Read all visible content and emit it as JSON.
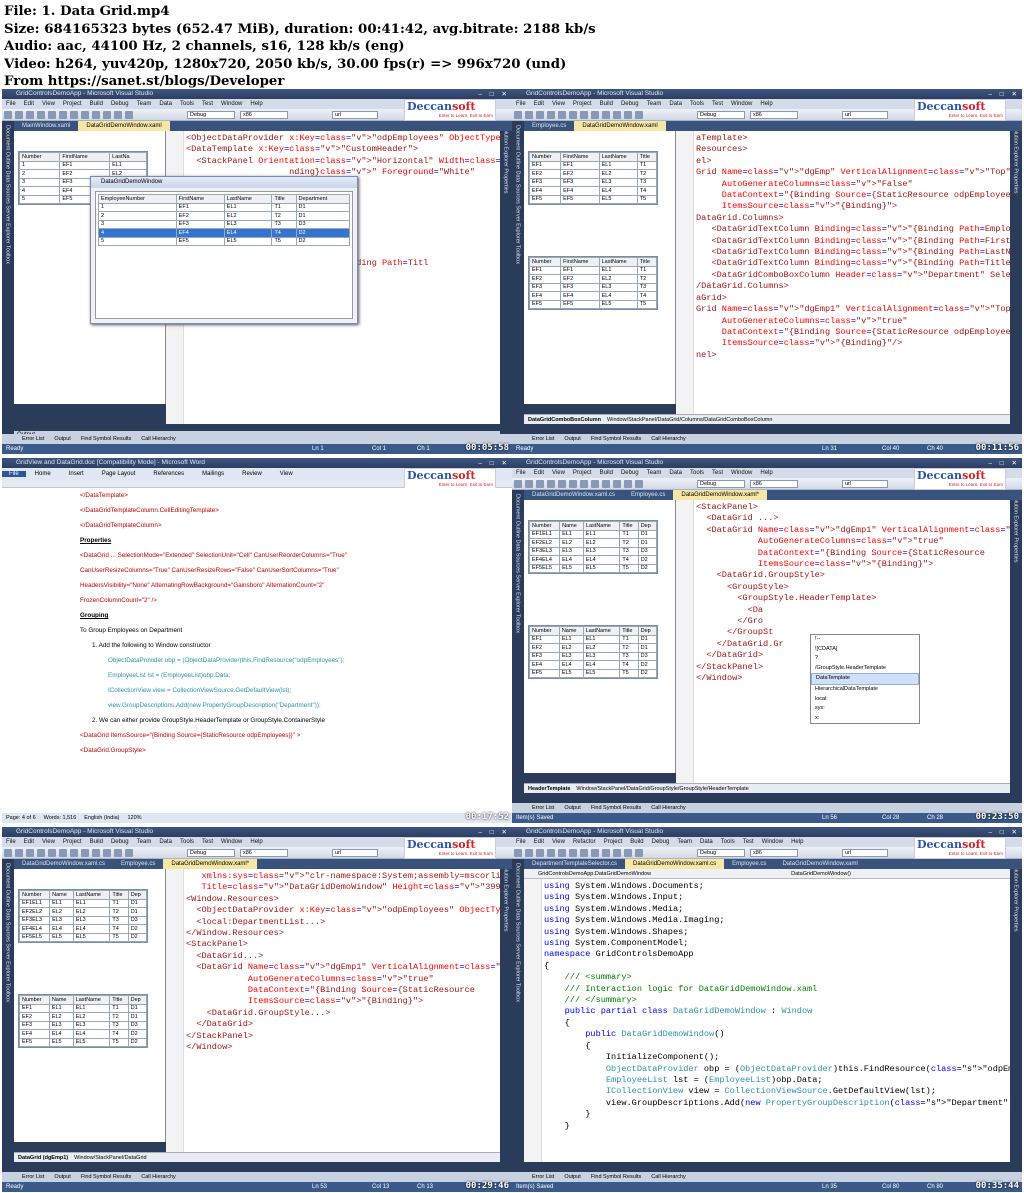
{
  "header": {
    "file": "File: 1. Data Grid.mp4",
    "size": "Size: 684165323 bytes (652.47 MiB), duration: 00:41:42, avg.bitrate: 2188 kb/s",
    "audio": "Audio: aac, 44100 Hz, 2 channels, s16, 128 kb/s (eng)",
    "video": "Video: h264, yuv420p, 1280x720, 2050 kb/s, 30.00 fps(r) => 996x720 (und)",
    "from": "From https://sanet.st/blogs/Developer"
  },
  "colors": {
    "vs_frame": "#2b3b5a",
    "tab_active": "#f7e7a6",
    "xaml_tag": "#a31515",
    "xaml_attr": "#ff0000",
    "xaml_value": "#0000ff",
    "csharp_keyword": "#0000ff",
    "csharp_type": "#2b91af",
    "comment": "#008000",
    "status_bar": "#3a5a8a"
  },
  "vs": {
    "title": "GridControlsDemoApp - Microsoft Visual Studio",
    "menu": [
      "File",
      "Edit",
      "View",
      "Project",
      "Build",
      "Debug",
      "Team",
      "Data",
      "Tools",
      "Test",
      "Window",
      "Help"
    ],
    "menu_refactor": [
      "File",
      "Edit",
      "View",
      "Refactor",
      "Project",
      "Build",
      "Debug",
      "Team",
      "Data",
      "Tools",
      "Test",
      "Window",
      "Help"
    ],
    "config": "Debug",
    "platform": "x86",
    "find": "url",
    "logo": {
      "brand_a": "Deccan",
      "brand_b": "soft",
      "tagline": "Enter to Learn, Exit to Earn"
    },
    "left_panel": "Document Outline  Data Sources  Server Explorer  Toolbox",
    "right_panel": "Solution Explorer  Properties",
    "bottom_tabs": [
      "Error List",
      "Output",
      "Find Symbol Results",
      "Call Hierarchy"
    ],
    "status_ready": "Ready",
    "status_saved": "Item(s) Saved",
    "zoom": "100 %"
  },
  "grid_headers": [
    "EmployeeNumber",
    "FirstName",
    "LastName",
    "Title",
    "Department"
  ],
  "grid_headers_short": [
    "Number",
    "FirstName",
    "LastNa"
  ],
  "grid_rows": [
    [
      "1",
      "EF1",
      "EL1",
      "T1",
      "D1"
    ],
    [
      "2",
      "EF2",
      "EL2",
      "T2",
      "D1"
    ],
    [
      "3",
      "EF3",
      "EL3",
      "T3",
      "D3"
    ],
    [
      "4",
      "EF4",
      "EL4",
      "T4",
      "D2"
    ],
    [
      "5",
      "EF5",
      "EL5",
      "T5",
      "D2"
    ]
  ],
  "tiles": [
    {
      "tabs": [
        "MainWindow.xaml",
        "DataGridDemoWindow.xaml"
      ],
      "popup_title": "DataGridDemoWindow",
      "output_title": "Output",
      "output_from": "Show output from:",
      "output_source": "Build",
      "status": {
        "ln": "Ln 1",
        "col": "Col 1",
        "ch": "Ch 1"
      },
      "time": "00:05:58",
      "code": [
        "<ObjectDataProvider x:Key=\"odpEmployees\" ObjectType=\"{x",
        "<DataTemplate x:Key=\"CustomHeader\">",
        "  <StackPanel Orientation=\"Horizontal\" Width=\"100\" Ba",
        "                    nding}\" Foreground=\"White\"",
        "",
        "",
        "",
        "lAlignment=\"Top\"",
        "\"False\"",
        "ng Source={StaticResource",
        "}\">",
        "",
        "Binding=\"{Binding Path=Empl",
        "Binding=\"{Binding Path=Firs",
        "Binding=\"{Binding Path=Last",
        "<DataGridTextColumn Binding=\"{Binding Path=Titl"
      ]
    },
    {
      "tabs": [
        "Employee.cs",
        "DataGridDemoWindow.xaml"
      ],
      "breadcrumb_bold": "DataGridComboBoxColumn",
      "breadcrumb": "Window/StackPanel/DataGrid/Columns/DataGridComboBoxColumn",
      "status": {
        "ln": "Ln 31",
        "col": "Col 40",
        "ch": "Ch 40"
      },
      "time": "00:11:56",
      "code": [
        "aTemplate>",
        "Resources>",
        "el>",
        "Grid Name=\"dgEmp\" VerticalAlignment=\"Top\"",
        "     AutoGenerateColumns=\"False\"",
        "     DataContext=\"{Binding Source={StaticResource odpEmployees}",
        "     ItemsSource=\"{Binding}\">",
        "DataGrid.Columns>",
        "   <DataGridTextColumn Binding=\"{Binding Path=EmployeeNumber}\"",
        "   <DataGridTextColumn Binding=\"{Binding Path=FirstName}\" Heade",
        "   <DataGridTextColumn Binding=\"{Binding Path=LastName}\" Header",
        "   <DataGridTextColumn Binding=\"{Binding Path=Title}\" Header=\"T",
        "   <DataGridComboBoxColumn Header=\"Department\" SelectedItemBind",
        "/DataGrid.Columns>",
        "aGrid>",
        "Grid Name=\"dgEmp1\" VerticalAlignment=\"Top\"",
        "     AutoGenerateColumns=\"true\"",
        "     DataContext=\"{Binding Source={StaticResource odpEmployees}",
        "     ItemsSource=\"{Binding}\"/>",
        "",
        "nel>"
      ]
    },
    {
      "title": "GridView and DataGrid.doc [Compatibility Mode] - Microsoft Word",
      "ribbon": [
        "File",
        "Home",
        "Insert",
        "Page Layout",
        "References",
        "Mailings",
        "Review",
        "View"
      ],
      "status": {
        "page": "Page: 4 of 6",
        "words": "Words: 1,516",
        "lang": "English (India)",
        "zoom": "120%"
      },
      "time": "00:17:52",
      "doc": [
        "</DataTemplate>",
        "</DataGridTemplateColumn.CellEditingTemplate>",
        "</DataGridTemplateColumn>",
        "",
        "Properties",
        "<DataGrid ... SelectionMode=\"Extended\" SelectionUnit=\"Cell\" CanUserReorderColumns=\"True\"",
        "CanUserResizeColumns=\"True\" CanUserResizeRows=\"False\" CanUserSortColumns=\"True\"",
        "HeadersVisibility=\"None\" AlternatingRowBackground=\"Gainsboro\"  AlternationCount=\"2\"",
        "FrozenColumnCount=\"2\" />",
        "",
        "Grouping",
        "To Group Employees on Department",
        "1.    Add the following to Window constructor",
        "ObjectDataProvider obp = (ObjectDataProvider)this.FindResource(\"odpEmployees\");",
        "EmployeeList lst = (EmployeeList)obp.Data;",
        "ICollectionView view = CollectionViewSource.GetDefaultView(lst);",
        "view.GroupDescriptions.Add(new PropertyGroupDescription(\"Department\"));",
        "2.    We can either provide GroupStyle.HeaderTemplate or GroupStyle.ContainerStyle",
        "<DataGrid ItemsSource=\"{Binding Source={StaticResource odpEmployees}}\" >",
        "<DataGrid.GroupStyle>"
      ]
    },
    {
      "tabs": [
        "DataGridDemoWindow.xaml.cs",
        "Employee.cs",
        "DataGridDemoWindow.xaml*"
      ],
      "breadcrumb_bold": "HeaderTemplate",
      "breadcrumb": "Window/StackPanel/DataGrid/GroupStyle/GroupStyle/HeaderTemplate",
      "status": {
        "ln": "Ln 56",
        "col": "Col 28",
        "ch": "Ch 28"
      },
      "time": "00:23:50",
      "intellisense": [
        "!--",
        "![CDATA[",
        "?",
        "/GroupStyle.HeaderTemplate",
        "DataTemplate",
        "HierarchicalDataTemplate",
        "local:",
        "sys:",
        "x:"
      ],
      "code": [
        "<StackPanel>",
        "  <DataGrid ...>",
        "",
        "  <DataGrid Name=\"dgEmp1\" VerticalAlignment=\"Top\"",
        "            AutoGenerateColumns=\"true\"",
        "            DataContext=\"{Binding Source={StaticResource",
        "            ItemsSource=\"{Binding}\">",
        "    <DataGrid.GroupStyle>",
        "      <GroupStyle>",
        "        <GroupStyle.HeaderTemplate>",
        "          <Da",
        "        </Gro",
        "      </GroupSt",
        "    </DataGrid.Gr",
        "  </DataGrid>",
        "</StackPanel>",
        "</Window>"
      ]
    },
    {
      "tabs": [
        "DataGridDemoWindow.xaml.cs",
        "Employee.cs",
        "DataGridDemoWindow.xaml*"
      ],
      "breadcrumb_bold": "DataGrid (dgEmp1)",
      "breadcrumb": "Window/StackPanel/DataGrid",
      "status": {
        "ln": "Ln 53",
        "col": "Col 13",
        "ch": "Ch 13"
      },
      "time": "00:29:46",
      "code": [
        "   xmlns:sys=\"clr-namespace:System;assembly=mscorlib\"",
        "   Title=\"DataGridDemoWindow\" Height=\"399\" Width=\"300\">",
        "<Window.Resources>",
        "  <ObjectDataProvider x:Key=\"odpEmployees\" ObjectType=\"{x",
        "  <local:DepartmentList...>",
        "</Window.Resources>",
        "<StackPanel>",
        "  <DataGrid...>",
        "",
        "  <DataGrid Name=\"dgEmp1\" VerticalAlignment=\"Top\"",
        "            AutoGenerateColumns=\"true\"",
        "            DataContext=\"{Binding Source={StaticResource",
        "            ItemsSource=\"{Binding}\">",
        "",
        "    <DataGrid.GroupStyle...>",
        "  </DataGrid>",
        "</StackPanel>",
        "</Window>"
      ]
    },
    {
      "tabs": [
        "DepartmentTemplateSelector.cs",
        "DataGridDemoWindow.xaml.cs",
        "Employee.cs",
        "DataGridDemoWindow.xaml"
      ],
      "nav_left": "GridControlsDemoApp.DataGridDemoWindow",
      "nav_right": "DataGridDemoWindow()",
      "status": {
        "ln": "Ln 35",
        "col": "Col 80",
        "ch": "Ch 80"
      },
      "time": "00:35:44",
      "code": [
        "using System.Windows.Documents;",
        "using System.Windows.Input;",
        "using System.Windows.Media;",
        "using System.Windows.Media.Imaging;",
        "using System.Windows.Shapes;",
        "using System.ComponentModel;",
        "",
        "namespace GridControlsDemoApp",
        "{",
        "    /// <summary>",
        "    /// Interaction logic for DataGridDemoWindow.xaml",
        "    /// </summary>",
        "    public partial class DataGridDemoWindow : Window",
        "    {",
        "        public DataGridDemoWindow()",
        "        {",
        "            InitializeComponent();",
        "            ObjectDataProvider obp = (ObjectDataProvider)this.FindResource(\"odpEmployees\");",
        "            EmployeeList lst = (EmployeeList)obp.Data;",
        "            ICollectionView view = CollectionViewSource.GetDefaultView(lst);",
        "            view.GroupDescriptions.Add(new PropertyGroupDescription(\"Department\"));",
        "        }",
        "    }"
      ]
    }
  ]
}
